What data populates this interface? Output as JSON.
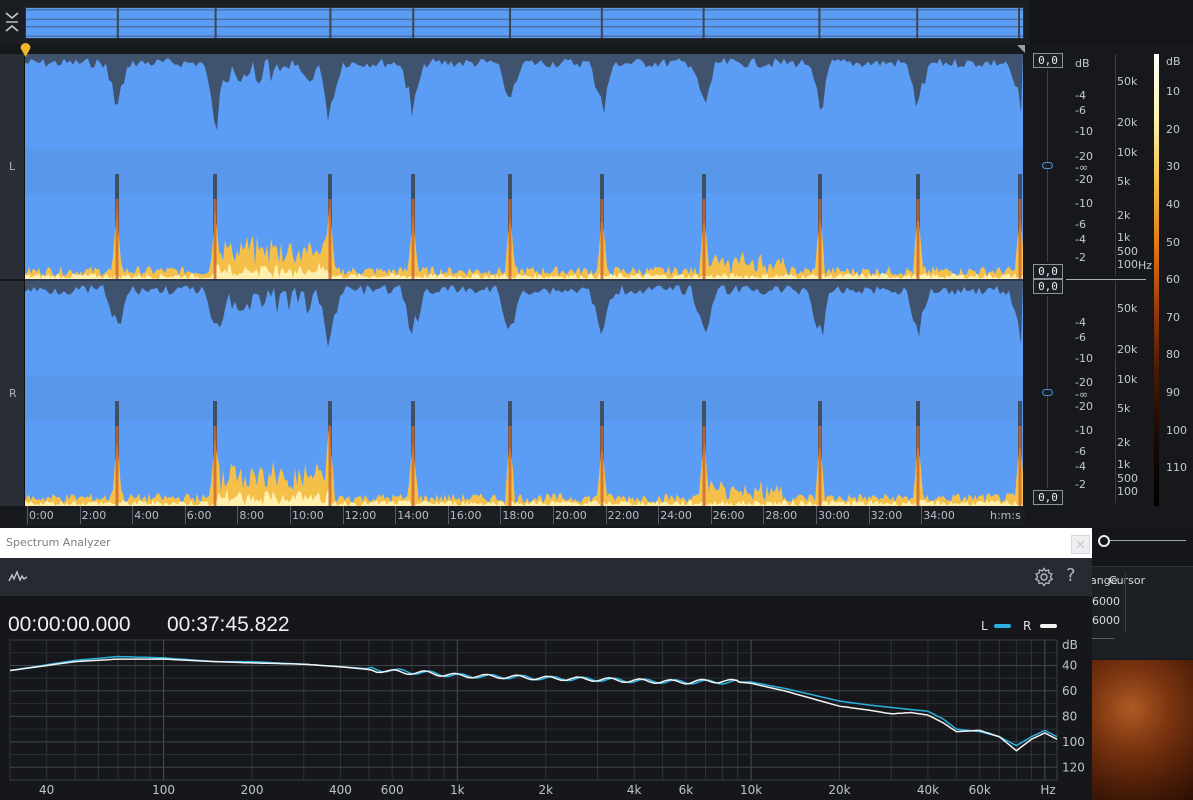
{
  "colors": {
    "waveform_fill": "#5b9cf5",
    "waveform_peak": "#3c4756",
    "spectro_hot": "#f5c04a",
    "spectro_core": "#fff0b0",
    "legend_L": "#2bb0e0",
    "legend_R": "#f2f2f2",
    "playhead": "#f3b52a"
  },
  "icons": {
    "collapse": "collapse-arrows-icon",
    "playhead": "playhead-marker-icon",
    "spectrum": "waveform-spectrum-icon",
    "settings": "gear-icon",
    "help": "question-mark-icon",
    "close": "close-icon"
  },
  "channels": [
    {
      "label": "L",
      "gain_top": "0,0",
      "gain_bottom": "0,0"
    },
    {
      "label": "R",
      "gain_top": "0,0",
      "gain_bottom": "0,0"
    }
  ],
  "db_scale": {
    "unit": "dB",
    "upper": [
      "-4",
      "-6",
      "-10",
      "-20"
    ],
    "center": "-∞",
    "lower": [
      "-20",
      "-10",
      "-6",
      "-4",
      "-2"
    ]
  },
  "hz_scale": {
    "unit": "Hz",
    "ticks": [
      "50k",
      "20k",
      "10k",
      "5k",
      "2k",
      "1k",
      "500",
      "100"
    ]
  },
  "color_scale": {
    "unit": "dB",
    "ticks": [
      "10",
      "20",
      "30",
      "40",
      "50",
      "60",
      "70",
      "80",
      "90",
      "100",
      "110"
    ]
  },
  "timeline": {
    "ticks": [
      "0:00",
      "2:00",
      "4:00",
      "6:00",
      "8:00",
      "10:00",
      "12:00",
      "14:00",
      "16:00",
      "18:00",
      "20:00",
      "22:00",
      "24:00",
      "26:00",
      "28:00",
      "30:00",
      "32:00",
      "34:00"
    ],
    "unit": "h:m:s"
  },
  "side_panel": {
    "range_header": "ange",
    "cursor_header": "Cursor",
    "values": [
      "6000",
      "6000"
    ]
  },
  "spectrum_analyzer": {
    "title": "Spectrum Analyzer",
    "start_time": "00:00:00.000",
    "end_time": "00:37:45.822",
    "legend": [
      {
        "label": "L",
        "color": "#2bb0e0"
      },
      {
        "label": "R",
        "color": "#f2f2f2"
      }
    ]
  },
  "chart_data": {
    "type": "line",
    "xscale": "log",
    "xlabel": "Hz",
    "ylabel": "dB",
    "x_ticks": [
      "40",
      "100",
      "200",
      "400",
      "600",
      "1k",
      "2k",
      "4k",
      "6k",
      "10k",
      "20k",
      "40k",
      "60k",
      "Hz"
    ],
    "y_ticks": [
      "dB",
      "40",
      "60",
      "80",
      "100",
      "120"
    ],
    "ylim": [
      20,
      130
    ],
    "xlim": [
      30,
      110000
    ],
    "grid": true,
    "legend_position": "top-right",
    "series": [
      {
        "name": "L",
        "color": "#2bb0e0",
        "points": [
          [
            30,
            44
          ],
          [
            50,
            36
          ],
          [
            70,
            33
          ],
          [
            100,
            34
          ],
          [
            150,
            37
          ],
          [
            200,
            37
          ],
          [
            300,
            39
          ],
          [
            400,
            41
          ],
          [
            600,
            44
          ],
          [
            800,
            46
          ],
          [
            1000,
            48
          ],
          [
            1500,
            49
          ],
          [
            2000,
            50
          ],
          [
            3000,
            51
          ],
          [
            4000,
            52
          ],
          [
            6000,
            53
          ],
          [
            8000,
            53
          ],
          [
            10000,
            53
          ],
          [
            13000,
            58
          ],
          [
            20000,
            68
          ],
          [
            25000,
            71
          ],
          [
            30000,
            73
          ],
          [
            40000,
            76
          ],
          [
            45000,
            82
          ],
          [
            50000,
            90
          ],
          [
            60000,
            92
          ],
          [
            70000,
            96
          ],
          [
            80000,
            103
          ],
          [
            90000,
            96
          ],
          [
            100000,
            91
          ],
          [
            110000,
            96
          ]
        ]
      },
      {
        "name": "R",
        "color": "#f2f2f2",
        "points": [
          [
            30,
            44
          ],
          [
            50,
            37
          ],
          [
            70,
            35
          ],
          [
            100,
            35
          ],
          [
            150,
            37
          ],
          [
            200,
            38
          ],
          [
            300,
            39
          ],
          [
            400,
            41
          ],
          [
            600,
            45
          ],
          [
            800,
            46
          ],
          [
            1000,
            48
          ],
          [
            1500,
            49
          ],
          [
            2000,
            50
          ],
          [
            3000,
            51
          ],
          [
            4000,
            52
          ],
          [
            6000,
            53
          ],
          [
            8000,
            52
          ],
          [
            10000,
            54
          ],
          [
            13000,
            60
          ],
          [
            20000,
            72
          ],
          [
            25000,
            75
          ],
          [
            30000,
            78
          ],
          [
            35000,
            77
          ],
          [
            40000,
            79
          ],
          [
            45000,
            85
          ],
          [
            50000,
            92
          ],
          [
            60000,
            91
          ],
          [
            70000,
            96
          ],
          [
            80000,
            107
          ],
          [
            90000,
            98
          ],
          [
            100000,
            93
          ],
          [
            110000,
            98
          ]
        ]
      }
    ]
  }
}
